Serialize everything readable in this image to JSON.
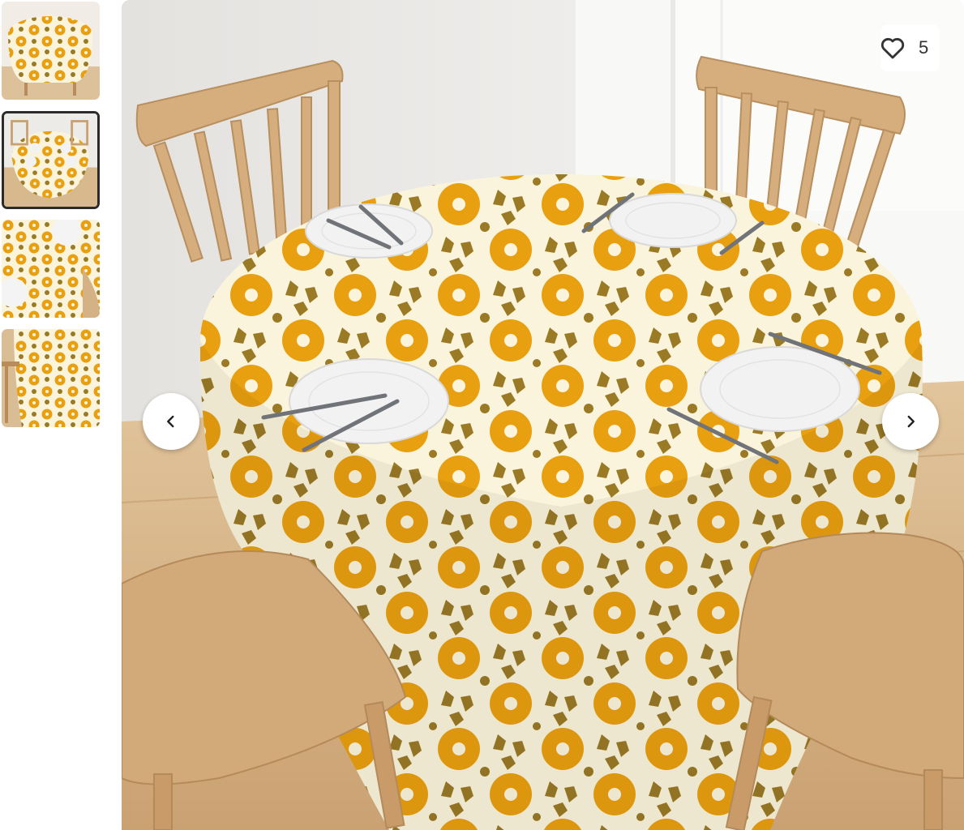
{
  "gallery": {
    "thumbnails": [
      {
        "name": "thumbnail-1",
        "selected": false
      },
      {
        "name": "thumbnail-2",
        "selected": true
      },
      {
        "name": "thumbnail-3",
        "selected": false
      },
      {
        "name": "thumbnail-4",
        "selected": false
      }
    ],
    "favorite": {
      "icon": "heart-outline-icon",
      "count": "5"
    },
    "prev_icon": "chevron-left-icon",
    "next_icon": "chevron-right-icon"
  },
  "colors": {
    "pattern_orange": "#e8a010",
    "pattern_brown": "#9a7a25",
    "pattern_cream": "#fbf4dc",
    "wood": "#d4ab7c",
    "plate": "#f2f2f2"
  }
}
